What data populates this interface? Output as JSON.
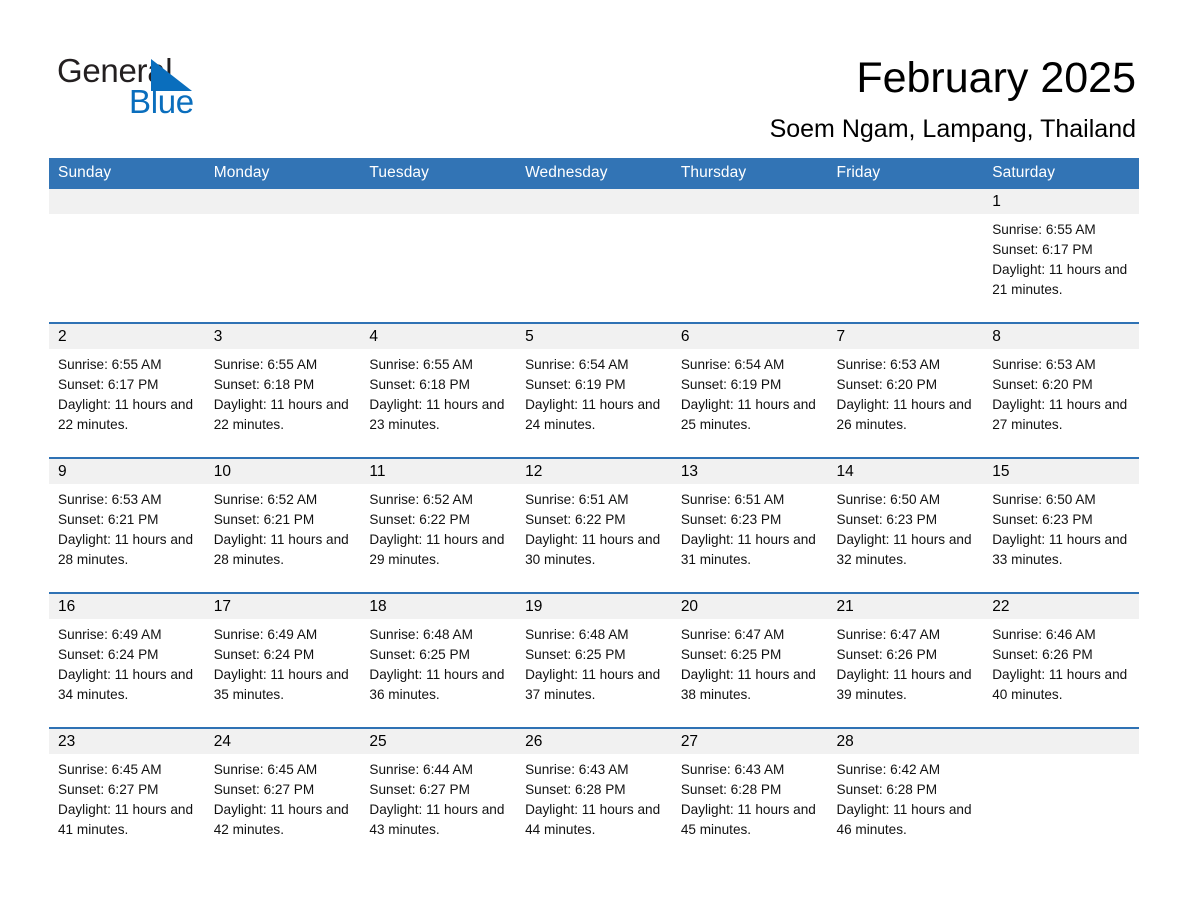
{
  "logo": {
    "word_one": "General",
    "word_two": "Blue",
    "triangle_color": "#0a6ebd"
  },
  "header": {
    "title": "February 2025",
    "subtitle": "Soem Ngam, Lampang, Thailand"
  },
  "theme": {
    "header_blue": "#3274b5",
    "rule_blue": "#2f72b4",
    "daynum_band": "#f1f1f1",
    "text": "#000000"
  },
  "weekdays": [
    "Sunday",
    "Monday",
    "Tuesday",
    "Wednesday",
    "Thursday",
    "Friday",
    "Saturday"
  ],
  "weeks": [
    [
      {
        "day": ""
      },
      {
        "day": ""
      },
      {
        "day": ""
      },
      {
        "day": ""
      },
      {
        "day": ""
      },
      {
        "day": ""
      },
      {
        "day": "1",
        "sunrise": "Sunrise: 6:55 AM",
        "sunset": "Sunset: 6:17 PM",
        "daylight": "Daylight: 11 hours and 21 minutes."
      }
    ],
    [
      {
        "day": "2",
        "sunrise": "Sunrise: 6:55 AM",
        "sunset": "Sunset: 6:17 PM",
        "daylight": "Daylight: 11 hours and 22 minutes."
      },
      {
        "day": "3",
        "sunrise": "Sunrise: 6:55 AM",
        "sunset": "Sunset: 6:18 PM",
        "daylight": "Daylight: 11 hours and 22 minutes."
      },
      {
        "day": "4",
        "sunrise": "Sunrise: 6:55 AM",
        "sunset": "Sunset: 6:18 PM",
        "daylight": "Daylight: 11 hours and 23 minutes."
      },
      {
        "day": "5",
        "sunrise": "Sunrise: 6:54 AM",
        "sunset": "Sunset: 6:19 PM",
        "daylight": "Daylight: 11 hours and 24 minutes."
      },
      {
        "day": "6",
        "sunrise": "Sunrise: 6:54 AM",
        "sunset": "Sunset: 6:19 PM",
        "daylight": "Daylight: 11 hours and 25 minutes."
      },
      {
        "day": "7",
        "sunrise": "Sunrise: 6:53 AM",
        "sunset": "Sunset: 6:20 PM",
        "daylight": "Daylight: 11 hours and 26 minutes."
      },
      {
        "day": "8",
        "sunrise": "Sunrise: 6:53 AM",
        "sunset": "Sunset: 6:20 PM",
        "daylight": "Daylight: 11 hours and 27 minutes."
      }
    ],
    [
      {
        "day": "9",
        "sunrise": "Sunrise: 6:53 AM",
        "sunset": "Sunset: 6:21 PM",
        "daylight": "Daylight: 11 hours and 28 minutes."
      },
      {
        "day": "10",
        "sunrise": "Sunrise: 6:52 AM",
        "sunset": "Sunset: 6:21 PM",
        "daylight": "Daylight: 11 hours and 28 minutes."
      },
      {
        "day": "11",
        "sunrise": "Sunrise: 6:52 AM",
        "sunset": "Sunset: 6:22 PM",
        "daylight": "Daylight: 11 hours and 29 minutes."
      },
      {
        "day": "12",
        "sunrise": "Sunrise: 6:51 AM",
        "sunset": "Sunset: 6:22 PM",
        "daylight": "Daylight: 11 hours and 30 minutes."
      },
      {
        "day": "13",
        "sunrise": "Sunrise: 6:51 AM",
        "sunset": "Sunset: 6:23 PM",
        "daylight": "Daylight: 11 hours and 31 minutes."
      },
      {
        "day": "14",
        "sunrise": "Sunrise: 6:50 AM",
        "sunset": "Sunset: 6:23 PM",
        "daylight": "Daylight: 11 hours and 32 minutes."
      },
      {
        "day": "15",
        "sunrise": "Sunrise: 6:50 AM",
        "sunset": "Sunset: 6:23 PM",
        "daylight": "Daylight: 11 hours and 33 minutes."
      }
    ],
    [
      {
        "day": "16",
        "sunrise": "Sunrise: 6:49 AM",
        "sunset": "Sunset: 6:24 PM",
        "daylight": "Daylight: 11 hours and 34 minutes."
      },
      {
        "day": "17",
        "sunrise": "Sunrise: 6:49 AM",
        "sunset": "Sunset: 6:24 PM",
        "daylight": "Daylight: 11 hours and 35 minutes."
      },
      {
        "day": "18",
        "sunrise": "Sunrise: 6:48 AM",
        "sunset": "Sunset: 6:25 PM",
        "daylight": "Daylight: 11 hours and 36 minutes."
      },
      {
        "day": "19",
        "sunrise": "Sunrise: 6:48 AM",
        "sunset": "Sunset: 6:25 PM",
        "daylight": "Daylight: 11 hours and 37 minutes."
      },
      {
        "day": "20",
        "sunrise": "Sunrise: 6:47 AM",
        "sunset": "Sunset: 6:25 PM",
        "daylight": "Daylight: 11 hours and 38 minutes."
      },
      {
        "day": "21",
        "sunrise": "Sunrise: 6:47 AM",
        "sunset": "Sunset: 6:26 PM",
        "daylight": "Daylight: 11 hours and 39 minutes."
      },
      {
        "day": "22",
        "sunrise": "Sunrise: 6:46 AM",
        "sunset": "Sunset: 6:26 PM",
        "daylight": "Daylight: 11 hours and 40 minutes."
      }
    ],
    [
      {
        "day": "23",
        "sunrise": "Sunrise: 6:45 AM",
        "sunset": "Sunset: 6:27 PM",
        "daylight": "Daylight: 11 hours and 41 minutes."
      },
      {
        "day": "24",
        "sunrise": "Sunrise: 6:45 AM",
        "sunset": "Sunset: 6:27 PM",
        "daylight": "Daylight: 11 hours and 42 minutes."
      },
      {
        "day": "25",
        "sunrise": "Sunrise: 6:44 AM",
        "sunset": "Sunset: 6:27 PM",
        "daylight": "Daylight: 11 hours and 43 minutes."
      },
      {
        "day": "26",
        "sunrise": "Sunrise: 6:43 AM",
        "sunset": "Sunset: 6:28 PM",
        "daylight": "Daylight: 11 hours and 44 minutes."
      },
      {
        "day": "27",
        "sunrise": "Sunrise: 6:43 AM",
        "sunset": "Sunset: 6:28 PM",
        "daylight": "Daylight: 11 hours and 45 minutes."
      },
      {
        "day": "28",
        "sunrise": "Sunrise: 6:42 AM",
        "sunset": "Sunset: 6:28 PM",
        "daylight": "Daylight: 11 hours and 46 minutes."
      },
      {
        "day": ""
      }
    ]
  ]
}
